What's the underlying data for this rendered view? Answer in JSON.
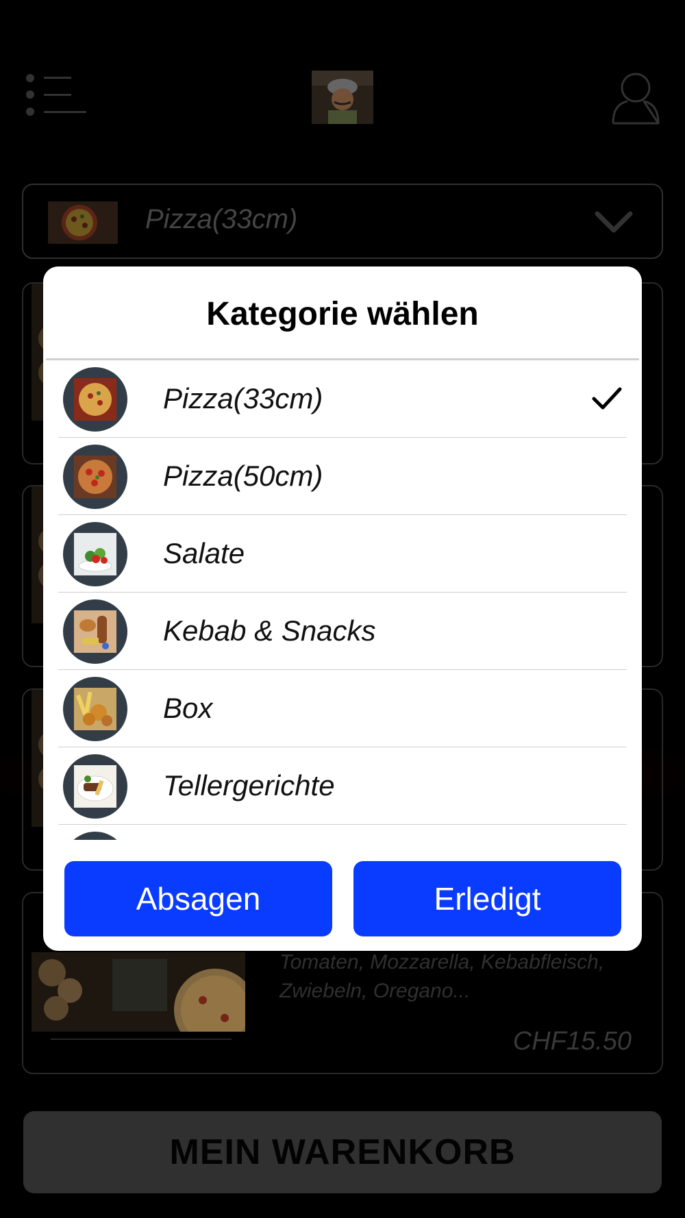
{
  "header": {
    "menu_icon": "list-menu-icon",
    "logo": "chef-logo",
    "user_icon": "user-profile-icon"
  },
  "category_select": {
    "value": "Pizza(33cm)",
    "icon": "chevron-down-icon"
  },
  "cards": [
    {
      "description": "",
      "price": ""
    },
    {
      "description": "",
      "price": ""
    },
    {
      "description": "",
      "price": ""
    },
    {
      "description": "Tomaten, Mozzarella, Kebabfleisch, Zwiebeln, Oregano...",
      "price": "CHF15.50"
    }
  ],
  "modal": {
    "title": "Kategorie wählen",
    "items": [
      {
        "label": "Pizza(33cm)",
        "selected": true
      },
      {
        "label": "Pizza(50cm)",
        "selected": false
      },
      {
        "label": "Salate",
        "selected": false
      },
      {
        "label": "Kebab & Snacks",
        "selected": false
      },
      {
        "label": "Box",
        "selected": false
      },
      {
        "label": "Tellergerichte",
        "selected": false
      },
      {
        "label": "",
        "selected": false
      }
    ],
    "cancel_label": "Absagen",
    "done_label": "Erledigt"
  },
  "cart": {
    "label": "MEIN WARENKORB"
  },
  "colors": {
    "primary_button": "#0a3cff",
    "background": "#000000",
    "modal": "#ffffff",
    "avatar_ring": "#333d48"
  }
}
